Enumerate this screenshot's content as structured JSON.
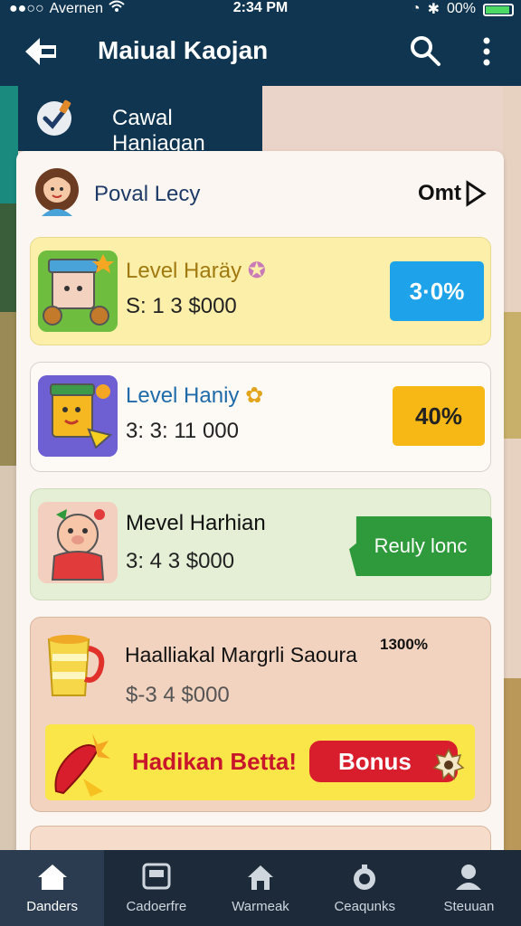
{
  "status_bar": {
    "carrier": "Avernen",
    "time": "2:34 PM",
    "battery": "00%"
  },
  "app_bar": {
    "title": "Maiual Kaojan"
  },
  "category_tab": {
    "label": "Cawal Haniagan"
  },
  "profile": {
    "name": "Poval Lecy",
    "action": "Omt"
  },
  "items": [
    {
      "name": "Level Haräy",
      "value": "S: 1 3 $000",
      "badge": "3·0%"
    },
    {
      "name": "Level Haniy",
      "value": "3: 3: 11 000",
      "badge": "40%"
    },
    {
      "name": "Mevel Harhian",
      "value": "3: 4 3 $000",
      "button": "Reuly lonc"
    },
    {
      "name": "Haalliakal Margrli Saoura",
      "value": "$-3 4 $000",
      "percent": "1300%"
    }
  ],
  "promo": {
    "text": "Hadikan Betta!",
    "button": "Bonus"
  },
  "bottom_nav": [
    {
      "label": "Danders",
      "icon": "home-icon",
      "active": true
    },
    {
      "label": "Cadoerfre",
      "icon": "card-icon",
      "active": false
    },
    {
      "label": "Warmeak",
      "icon": "house-icon",
      "active": false
    },
    {
      "label": "Ceaqunks",
      "icon": "coins-icon",
      "active": false
    },
    {
      "label": "Steuuan",
      "icon": "person-icon",
      "active": false
    }
  ],
  "colors": {
    "header": "#0f3550",
    "blue_badge": "#1ea3ea",
    "yellow_badge": "#f7b815",
    "green_button": "#2f9a3b",
    "red_button": "#d81e2c",
    "nav_bg": "#1c2a3a"
  }
}
